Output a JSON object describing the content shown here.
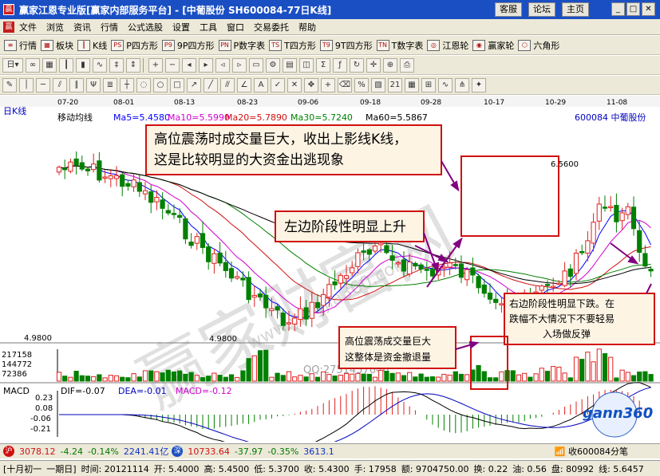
{
  "titlebar": {
    "title": "赢家江恩专业版[赢家内部服务平台] - [中葡股份   SH600084-77日K线]",
    "buttons": [
      "客服",
      "论坛",
      "主页"
    ]
  },
  "menu": [
    "文件",
    "浏览",
    "资讯",
    "行情",
    "公式选股",
    "设置",
    "工具",
    "窗口",
    "交易委托",
    "帮助"
  ],
  "toolbar1": [
    {
      "icon": "quote-icon",
      "label": "行情"
    },
    {
      "icon": "sector-icon",
      "label": "板块"
    },
    {
      "icon": "kline-icon",
      "label": "K线"
    },
    {
      "icon": "p-square-icon",
      "label": "P四方形"
    },
    {
      "icon": "9p-square-icon",
      "label": "9P四方形"
    },
    {
      "icon": "p-number-table-icon",
      "label": "P数字表"
    },
    {
      "icon": "t-square-icon",
      "label": "T四方形"
    },
    {
      "icon": "9t-square-icon",
      "label": "9T四方形"
    },
    {
      "icon": "t-number-table-icon",
      "label": "T数字表"
    },
    {
      "icon": "gann-wheel-icon",
      "label": "江恩轮"
    },
    {
      "icon": "winner-wheel-icon",
      "label": "赢家轮"
    },
    {
      "icon": "hexagon-icon",
      "label": "六角形"
    }
  ],
  "chart": {
    "period_label": "日K线",
    "indicator_label": "移动均线",
    "ma_values": [
      {
        "label": "Ma5=5.4580",
        "color": "#0000ff"
      },
      {
        "label": "Ma10=5.5990",
        "color": "#d000d0"
      },
      {
        "label": "Ma20=5.7890",
        "color": "#d01010"
      },
      {
        "label": "Ma30=5.7240",
        "color": "#008000"
      },
      {
        "label": "Ma60=5.5867",
        "color": "#000000"
      }
    ],
    "stock_label": "600084  中葡股份",
    "dates": [
      "07-20",
      "08-01",
      "08-13",
      "08-23",
      "09-06",
      "09-18",
      "09-28",
      "10-17",
      "10-29",
      "11-08"
    ],
    "high_label": "6.5600",
    "low_label": "4.9800",
    "axis_low": "4.9800",
    "volume_ticks": [
      "217158",
      "144772",
      "72386"
    ],
    "annotations": [
      "高位震荡时成交量巨大，收出上影线K线，",
      "这是比较明显的大资金出逃现象",
      "左边阶段性明显上升",
      "高位震荡成交量巨大",
      "这整体是资金撤退量",
      "右边阶段性明显下跌。在",
      "跌幅不大情况下不要轻易",
      "入场做反弹"
    ],
    "watermark": "赢家财富网",
    "watermark_sub": "www.yingjia360.com",
    "watermark_phone": "QQ:2751457646",
    "logo": "gann360",
    "macd_label": "MACD",
    "dif": "DIF=-0.07",
    "dea": "DEA=-0.01",
    "macd_value": "MACD=-0.12",
    "macd_ticks": [
      "0.23",
      "0.08",
      "-0.06",
      "-0.21"
    ]
  },
  "chart_data": {
    "type": "candlestick",
    "dates": [
      "07-20",
      "08-01",
      "08-13",
      "08-23",
      "09-06",
      "09-18",
      "09-28",
      "10-17",
      "10-29",
      "11-08"
    ],
    "high": 6.56,
    "low": 4.98,
    "volume_axis": [
      72386,
      144772,
      217158
    ],
    "macd": {
      "dif": -0.07,
      "dea": -0.01,
      "macd": -0.12,
      "axis": [
        -0.21,
        -0.06,
        0.08,
        0.23
      ]
    }
  },
  "statusbar1": {
    "sh_index": "3078.12",
    "sh_change": "-4.24",
    "sh_pct": "-0.14%",
    "sh_amount": "2241.41亿",
    "sz_index": "10733.64",
    "sz_change": "-37.97",
    "sz_pct": "-0.35%",
    "sz_amount": "3613.1",
    "msg": "收600084分笔"
  },
  "statusbar2": {
    "lunar": "[十月初一",
    "weekday": "一期日]",
    "time": "时间: 20121114",
    "open": "开: 5.4000",
    "high": "高: 5.4500",
    "low": "低: 5.3700",
    "close": "收: 5.4300",
    "hand": "手: 17958",
    "amount": "额: 9704750.00",
    "turnover": "换: 0.22",
    "volratio": "油: 0.56",
    "pan": "盘: 80992",
    "ratio": "线: 5.6457"
  }
}
